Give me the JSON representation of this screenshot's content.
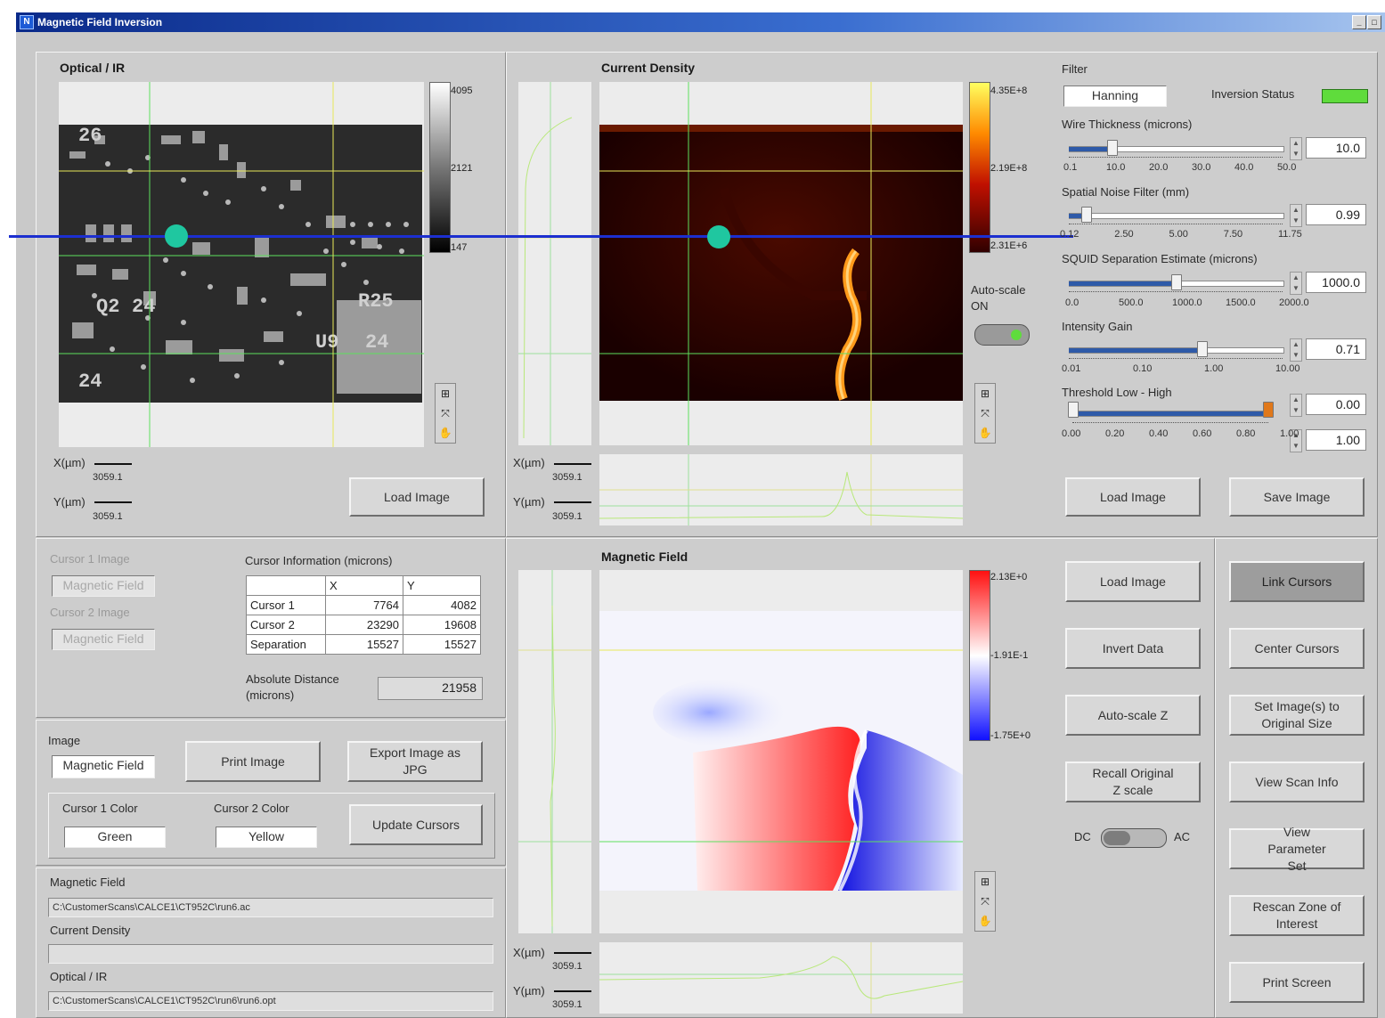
{
  "window": {
    "title": "Magnetic Field Inversion",
    "min_btn": "_",
    "max_btn": "□",
    "logo": "N"
  },
  "optical": {
    "title": "Optical / IR",
    "cbar_ticks": [
      "4095",
      "2121",
      "147"
    ],
    "x_label": "X(µm)",
    "x_value": "3059.1",
    "y_label": "Y(µm)",
    "y_value": "3059.1",
    "load_label": "Load Image"
  },
  "current": {
    "title": "Current Density",
    "cbar_ticks": [
      "4.35E+8",
      "2.19E+8",
      "2.31E+6"
    ],
    "autoscale_label": "Auto-scale",
    "autoscale_state": "ON",
    "x_label": "X(µm)",
    "x_value": "3059.1",
    "y_label": "Y(µm)",
    "y_value": "3059.1"
  },
  "controls": {
    "filter_label": "Filter",
    "filter_value": "Hanning",
    "inversion_status_label": "Inversion Status",
    "status_color": "#5fdc3c",
    "wire_label": "Wire Thickness (microns)",
    "wire_value": "10.0",
    "wire_scale": [
      "0.1",
      "10.0",
      "20.0",
      "30.0",
      "40.0",
      "50.0"
    ],
    "wire_fraction": 0.2,
    "noise_label": "Spatial Noise Filter (mm)",
    "noise_value": "0.99",
    "noise_scale": [
      "0.12",
      "2.50",
      "5.00",
      "7.50",
      "11.75"
    ],
    "noise_fraction": 0.08,
    "squid_label": "SQUID Separation Estimate (microns)",
    "squid_value": "1000.0",
    "squid_scale": [
      "0.0",
      "500.0",
      "1000.0",
      "1500.0",
      "2000.0"
    ],
    "squid_fraction": 0.5,
    "gain_label": "Intensity Gain",
    "gain_value": "0.71",
    "gain_scale": [
      "0.01",
      "0.10",
      "1.00",
      "10.00"
    ],
    "gain_fraction": 0.62,
    "threshold_label": "Threshold Low - High",
    "threshold_low": "0.00",
    "threshold_high": "1.00",
    "threshold_scale": [
      "0.00",
      "0.20",
      "0.40",
      "0.60",
      "0.80",
      "1.00"
    ],
    "load_label": "Load Image",
    "save_label": "Save Image"
  },
  "cursor_panel": {
    "c1_image_label": "Cursor 1 Image",
    "c1_image_value": "Magnetic Field",
    "c2_image_label": "Cursor 2 Image",
    "c2_image_value": "Magnetic Field",
    "info_label": "Cursor Information (microns)",
    "headers": [
      "",
      "X",
      "Y"
    ],
    "rows": [
      [
        "Cursor 1",
        "7764",
        "4082"
      ],
      [
        "Cursor 2",
        "23290",
        "19608"
      ],
      [
        "Separation",
        "15527",
        "15527"
      ]
    ],
    "abs_label": "Absolute Distance\n(microns)",
    "abs_value": "21958"
  },
  "image_panel": {
    "image_label": "Image",
    "image_value": "Magnetic Field",
    "print_label": "Print Image",
    "export_label": "Export Image as JPG",
    "c1_color_label": "Cursor 1 Color",
    "c1_color_value": "Green",
    "c2_color_label": "Cursor 2 Color",
    "c2_color_value": "Yellow",
    "update_label": "Update Cursors"
  },
  "files": {
    "mag_label": "Magnetic Field",
    "mag_path": "C:\\CustomerScans\\CALCE1\\CT952C\\run6.ac",
    "cd_label": "Current Density",
    "cd_path": "",
    "opt_label": "Optical / IR",
    "opt_path": "C:\\CustomerScans\\CALCE1\\CT952C\\run6\\run6.opt"
  },
  "magnetic": {
    "title": "Magnetic Field",
    "cbar_ticks": [
      "2.13E+0",
      "-1.91E-1",
      "-1.75E+0"
    ],
    "x_label": "X(µm)",
    "x_value": "3059.1",
    "y_label": "Y(µm)",
    "y_value": "3059.1"
  },
  "mag_buttons": {
    "load": "Load Image",
    "invert": "Invert Data",
    "autoscale": "Auto-scale Z",
    "recall": "Recall Original Z scale",
    "dc": "DC",
    "ac": "AC"
  },
  "right_buttons": {
    "link": "Link Cursors",
    "center": "Center Cursors",
    "setsize": "Set Image(s) to Original Size",
    "scaninfo": "View Scan Info",
    "paramset": "View Parameter Set",
    "rescan": "Rescan Zone of Interest",
    "print": "Print Screen"
  },
  "board_labels": [
    "26",
    "Q2",
    "24",
    "R25",
    "U9",
    "24",
    "24"
  ]
}
